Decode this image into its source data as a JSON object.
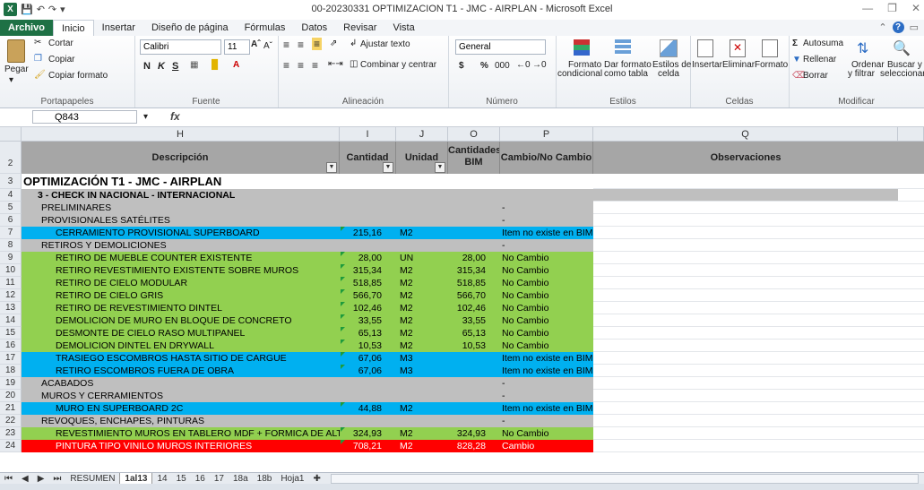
{
  "window": {
    "title": "00-20230331 OPTIMIZACION T1 - JMC - AIRPLAN - Microsoft Excel",
    "xl_icon": "X"
  },
  "tabs": [
    "Archivo",
    "Inicio",
    "Insertar",
    "Diseño de página",
    "Fórmulas",
    "Datos",
    "Revisar",
    "Vista"
  ],
  "ribbon": {
    "clipboard": {
      "paste": "Pegar",
      "cut": "Cortar",
      "copy": "Copiar",
      "format_painter": "Copiar formato",
      "label": "Portapapeles"
    },
    "font": {
      "name": "Calibri",
      "size": "11",
      "bold": "N",
      "italic": "K",
      "underline": "S",
      "label": "Fuente"
    },
    "alignment": {
      "wrap": "Ajustar texto",
      "merge": "Combinar y centrar",
      "label": "Alineación"
    },
    "number": {
      "format": "General",
      "currency": "$",
      "percent": "%",
      "thousands": "000",
      "label": "Número"
    },
    "styles": {
      "cond": "Formato",
      "cond2": "condicional",
      "table": "Dar formato",
      "table2": "como tabla",
      "cell": "Estilos de",
      "cell2": "celda",
      "label": "Estilos"
    },
    "cells": {
      "insert": "Insertar",
      "delete": "Eliminar",
      "format": "Formato",
      "label": "Celdas"
    },
    "editing": {
      "autosum": "Autosuma",
      "fill": "Rellenar",
      "clear": "Borrar",
      "sort": "Ordenar",
      "sort2": "y filtrar",
      "find": "Buscar y",
      "find2": "seleccionar",
      "label": "Modificar"
    }
  },
  "formula_bar": {
    "name_box": "Q843",
    "fx": "fx",
    "value": ""
  },
  "columns": [
    "H",
    "I",
    "J",
    "O",
    "P",
    "Q"
  ],
  "header_row": {
    "num": "2",
    "desc": "Descripción",
    "qty": "Cantidad",
    "unit": "Unidad",
    "bim": "Cantidades BIM",
    "change": "Cambio/No Cambio",
    "obs": "Observaciones"
  },
  "rows": [
    {
      "num": "3",
      "desc": "OPTIMIZACIÓN T1 - JMC - AIRPLAN",
      "qty": "",
      "unit": "",
      "bim": "",
      "change": "",
      "style": "title"
    },
    {
      "num": "4",
      "desc": "3 - CHECK IN NACIONAL - INTERNACIONAL",
      "qty": "",
      "unit": "",
      "bim": "",
      "change": "",
      "style": "section"
    },
    {
      "num": "5",
      "desc": "PRELIMINARES",
      "qty": "",
      "unit": "",
      "bim": "",
      "change": "-",
      "style": "gray"
    },
    {
      "num": "6",
      "desc": "PROVISIONALES SATÉLITES",
      "qty": "",
      "unit": "",
      "bim": "",
      "change": "-",
      "style": "gray"
    },
    {
      "num": "7",
      "desc": "CERRAMIENTO PROVISIONAL SUPERBOARD",
      "qty": "215,16",
      "unit": "M2",
      "bim": "",
      "change": "Item no existe en BIM",
      "style": "blue"
    },
    {
      "num": "8",
      "desc": "RETIROS Y DEMOLICIONES",
      "qty": "",
      "unit": "",
      "bim": "",
      "change": "-",
      "style": "gray"
    },
    {
      "num": "9",
      "desc": "RETIRO DE MUEBLE COUNTER EXISTENTE",
      "qty": "28,00",
      "unit": "UN",
      "bim": "28,00",
      "change": "No Cambio",
      "style": "green"
    },
    {
      "num": "10",
      "desc": "RETIRO REVESTIMIENTO EXISTENTE SOBRE MUROS",
      "qty": "315,34",
      "unit": "M2",
      "bim": "315,34",
      "change": "No Cambio",
      "style": "green"
    },
    {
      "num": "11",
      "desc": "RETIRO DE CIELO MODULAR",
      "qty": "518,85",
      "unit": "M2",
      "bim": "518,85",
      "change": "No Cambio",
      "style": "green"
    },
    {
      "num": "12",
      "desc": "RETIRO DE CIELO GRIS",
      "qty": "566,70",
      "unit": "M2",
      "bim": "566,70",
      "change": "No Cambio",
      "style": "green"
    },
    {
      "num": "13",
      "desc": "RETIRO DE REVESTIMIENTO DINTEL",
      "qty": "102,46",
      "unit": "M2",
      "bim": "102,46",
      "change": "No Cambio",
      "style": "green"
    },
    {
      "num": "14",
      "desc": "DEMOLICION DE MURO EN BLOQUE DE CONCRETO",
      "qty": "33,55",
      "unit": "M2",
      "bim": "33,55",
      "change": "No Cambio",
      "style": "green"
    },
    {
      "num": "15",
      "desc": "DESMONTE DE CIELO RASO MULTIPANEL",
      "qty": "65,13",
      "unit": "M2",
      "bim": "65,13",
      "change": "No Cambio",
      "style": "green"
    },
    {
      "num": "16",
      "desc": "DEMOLICION DINTEL EN DRYWALL",
      "qty": "10,53",
      "unit": "M2",
      "bim": "10,53",
      "change": "No Cambio",
      "style": "green"
    },
    {
      "num": "17",
      "desc": "TRASIEGO ESCOMBROS HASTA SITIO DE CARGUE",
      "qty": "67,06",
      "unit": "M3",
      "bim": "",
      "change": "Item no existe en BIM",
      "style": "blue"
    },
    {
      "num": "18",
      "desc": "RETIRO ESCOMBROS FUERA DE OBRA",
      "qty": "67,06",
      "unit": "M3",
      "bim": "",
      "change": "Item no existe en BIM",
      "style": "blue"
    },
    {
      "num": "19",
      "desc": "ACABADOS",
      "qty": "",
      "unit": "",
      "bim": "",
      "change": "-",
      "style": "gray"
    },
    {
      "num": "20",
      "desc": "MUROS Y CERRAMIENTOS",
      "qty": "",
      "unit": "",
      "bim": "",
      "change": "-",
      "style": "gray"
    },
    {
      "num": "21",
      "desc": "MURO EN SUPERBOARD 2C",
      "qty": "44,88",
      "unit": "M2",
      "bim": "",
      "change": "Item no existe en BIM",
      "style": "blue"
    },
    {
      "num": "22",
      "desc": "REVOQUES, ENCHAPES, PINTURAS",
      "qty": "",
      "unit": "",
      "bim": "",
      "change": "-",
      "style": "gray"
    },
    {
      "num": "23",
      "desc": "REVESTIMIENTO MUROS EN TABLERO MDF + FORMICA DE ALTO I",
      "qty": "324,93",
      "unit": "M2",
      "bim": "324,93",
      "change": "No Cambio",
      "style": "green"
    },
    {
      "num": "24",
      "desc": "PINTURA TIPO VINILO MUROS INTERIORES",
      "qty": "708,21",
      "unit": "M2",
      "bim": "828,28",
      "change": "Cambio",
      "style": "red"
    }
  ],
  "sheets": [
    "RESUMEN",
    "1al13",
    "14",
    "15",
    "16",
    "17",
    "18a",
    "18b",
    "Hoja1"
  ],
  "active_sheet": "1al13",
  "colors": {
    "green": "#92d050",
    "blue": "#00b0f0",
    "gray": "#bfbfbf",
    "red": "#ff0000",
    "header": "#a6a6a6",
    "excel": "#1e7145"
  }
}
